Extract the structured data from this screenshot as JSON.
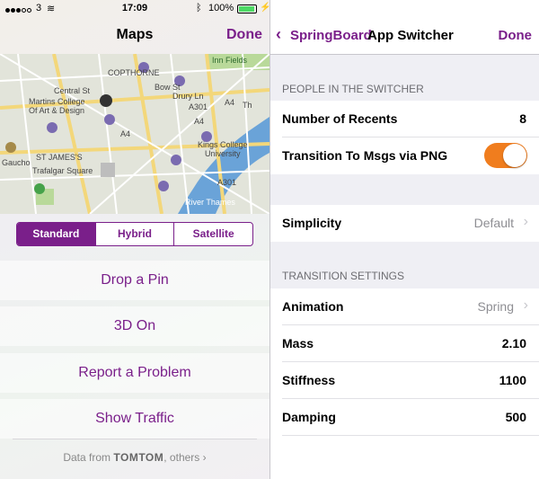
{
  "status": {
    "carrier": "3",
    "time": "17:09",
    "battery": "100%"
  },
  "maps": {
    "title": "Maps",
    "done": "Done",
    "map_labels": [
      "COPTHORNE",
      "Inn Fields",
      "Central St",
      "Martins College",
      "Of Art & Design",
      "Bow St",
      "Drury Ln",
      "A301",
      "A4",
      "A4",
      "A4",
      "Kings College",
      "University",
      "Gaucho",
      "ST JAMES'S",
      "Trafalgar Square",
      "River Thames",
      "A301",
      "Th"
    ],
    "segments": [
      {
        "label": "Standard",
        "active": true
      },
      {
        "label": "Hybrid",
        "active": false
      },
      {
        "label": "Satellite",
        "active": false
      }
    ],
    "actions": [
      "Drop a Pin",
      "3D On",
      "Report a Problem",
      "Show Traffic"
    ],
    "attribution_prefix": "Data from",
    "attribution_brand": "TOMTOM",
    "attribution_suffix": ", others",
    "attribution_chevron": "›"
  },
  "settings": {
    "back_label": "SpringBoard",
    "title": "App Switcher",
    "done": "Done",
    "section1": "PEOPLE IN THE SWITCHER",
    "recents_label": "Number of Recents",
    "recents_value": "8",
    "transition_label": "Transition To Msgs via PNG",
    "transition_on": true,
    "simplicity_label": "Simplicity",
    "simplicity_value": "Default",
    "section2": "TRANSITION SETTINGS",
    "animation_label": "Animation",
    "animation_value": "Spring",
    "mass_label": "Mass",
    "mass_value": "2.10",
    "stiffness_label": "Stiffness",
    "stiffness_value": "1100",
    "damping_label": "Damping",
    "damping_value": "500"
  },
  "colors": {
    "accent": "#7a1f8a",
    "toggle_on": "#f07d1e"
  }
}
